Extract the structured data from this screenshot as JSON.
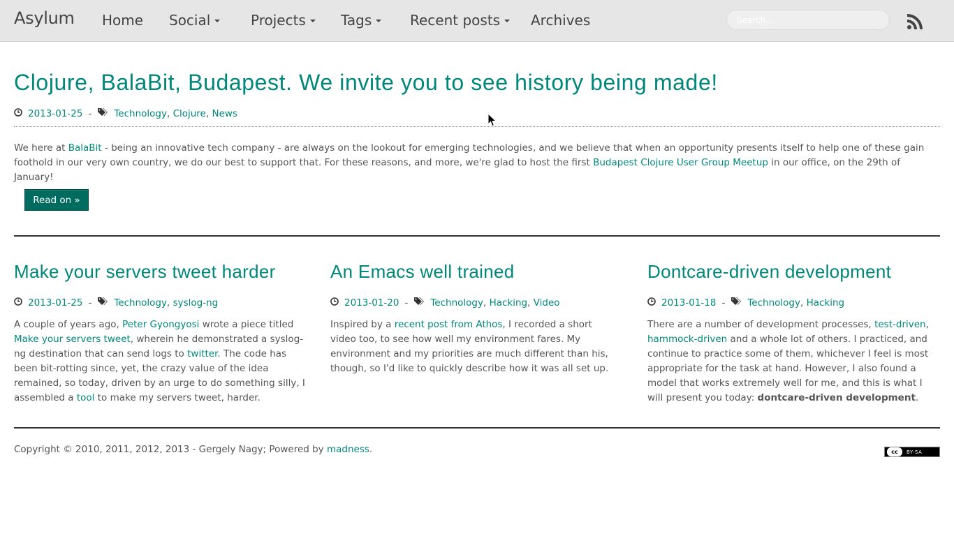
{
  "navbar": {
    "brand": "Asylum",
    "items": [
      {
        "label": "Home",
        "dropdown": false
      },
      {
        "label": "Social",
        "dropdown": true
      },
      {
        "label": "Projects",
        "dropdown": true
      },
      {
        "label": "Tags",
        "dropdown": true
      },
      {
        "label": "Recent posts",
        "dropdown": true
      },
      {
        "label": "Archives",
        "dropdown": false
      }
    ],
    "search_placeholder": "Search...",
    "rss_icon": "rss-icon"
  },
  "featured": {
    "title": "Clojure, BalaBit, Budapest. We invite you to see history being made!",
    "date": "2013-01-25",
    "tags": [
      "Technology",
      "Clojure",
      "News"
    ],
    "excerpt": {
      "p1": "We here at ",
      "link1": "BalaBit",
      "p2": " - being an innovative tech company - are always on the lookout for emerging technologies, and we believe that when an opportunity presents itself to help one of these gain foothold in our very own country, we do our best to support that. For these reasons, and more, we're glad to host the first ",
      "link2": "Budapest Clojure User Group Meetup",
      "p3": " in our office, on the 29th of January!"
    },
    "read_on": "Read on »"
  },
  "posts": [
    {
      "title": "Make your servers tweet harder",
      "date": "2013-01-25",
      "tags": [
        "Technology",
        "syslog-ng"
      ],
      "t1": "A couple of years ago, ",
      "l1": "Peter Gyongyosi",
      "t2": " wrote a piece titled ",
      "l2": "Make your servers tweet",
      "t3": ", wherein he demonstrated a syslog-ng destination that can send logs to ",
      "l3": "twitter",
      "t4": ". The code has been bit-rotting since, yet, the crazy value of the idea remained, so today, driven by an urge to do something silly, I assembled a ",
      "l4": "tool",
      "t5": " to make my servers tweet, harder."
    },
    {
      "title": "An Emacs well trained",
      "date": "2013-01-20",
      "tags": [
        "Technology",
        "Hacking",
        "Video"
      ],
      "t1": "Inspired by a ",
      "l1": "recent post from Athos",
      "t2": ", I recorded a short video too, to see how well my environment fares. My environment and my priorities are much different than his, though, so I'd like to quickly describe how it was all set up."
    },
    {
      "title": "Dontcare-driven development",
      "date": "2013-01-18",
      "tags": [
        "Technology",
        "Hacking"
      ],
      "t1": "There are a number of development processes, ",
      "l1": "test-driven",
      "t2": ", ",
      "l2": "hammock-driven",
      "t3": " and a whole lot of others. I practiced, and continue to practice some of them, whichever I feel is most appropriate for the task at hand. However, I also found a model that works extremely well for me, and this is what I will present you today: ",
      "b1": "dontcare-driven development",
      "t4": "."
    }
  ],
  "footer": {
    "text": "Copyright © 2010, 2011, 2012, 2013 - Gergely Nagy; Powered by ",
    "link": "madness",
    "end": ".",
    "license_mark": "cc",
    "license_text": "BY-SA"
  },
  "colors": {
    "accent": "#00877a",
    "button": "#006b5f",
    "navbar_bg": "#e6e6e6"
  }
}
